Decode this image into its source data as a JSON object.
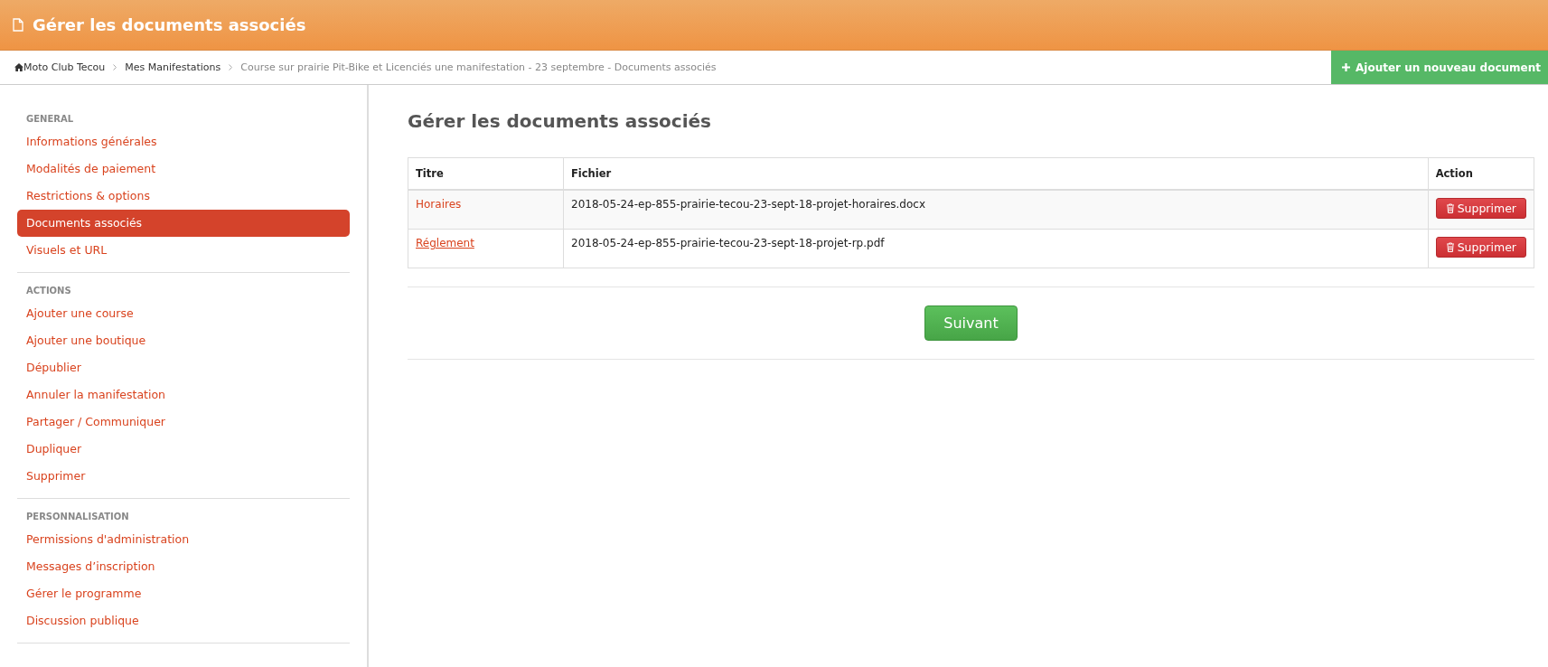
{
  "header": {
    "title": "Gérer les documents associés"
  },
  "breadcrumb": {
    "items": [
      {
        "label": "Moto Club Tecou",
        "kind": "home"
      },
      {
        "label": "Mes Manifestations",
        "kind": "link"
      },
      {
        "label": "Course sur prairie Pit-Bike et Licenciés une manifestation - 23 septembre - Documents associés",
        "kind": "current"
      }
    ],
    "action_button": "Ajouter un nouveau document"
  },
  "sidebar": {
    "sections": [
      {
        "heading": "GENERAL",
        "items": [
          {
            "label": "Informations générales",
            "selected": false
          },
          {
            "label": "Modalités de paiement",
            "selected": false
          },
          {
            "label": "Restrictions & options",
            "selected": false
          },
          {
            "label": "Documents associés",
            "selected": true
          },
          {
            "label": "Visuels et URL",
            "selected": false
          }
        ]
      },
      {
        "heading": "ACTIONS",
        "items": [
          {
            "label": "Ajouter une course",
            "selected": false
          },
          {
            "label": "Ajouter une boutique",
            "selected": false
          },
          {
            "label": "Dépublier",
            "selected": false
          },
          {
            "label": "Annuler la manifestation",
            "selected": false
          },
          {
            "label": "Partager / Communiquer",
            "selected": false
          },
          {
            "label": "Dupliquer",
            "selected": false
          },
          {
            "label": "Supprimer",
            "selected": false
          }
        ]
      },
      {
        "heading": "PERSONNALISATION",
        "items": [
          {
            "label": "Permissions d'administration",
            "selected": false
          },
          {
            "label": "Messages d’inscription",
            "selected": false
          },
          {
            "label": "Gérer le programme",
            "selected": false
          },
          {
            "label": "Discussion publique",
            "selected": false
          }
        ]
      }
    ]
  },
  "main": {
    "title": "Gérer les documents associés",
    "table": {
      "columns": [
        "Titre",
        "Fichier",
        "Action"
      ],
      "rows": [
        {
          "title": "Horaires",
          "file": "2018-05-24-ep-855-prairie-tecou-23-sept-18-projet-horaires.docx",
          "action": "Supprimer",
          "hovered": false
        },
        {
          "title": "Réglement",
          "file": "2018-05-24-ep-855-prairie-tecou-23-sept-18-projet-rp.pdf",
          "action": "Supprimer",
          "hovered": true
        }
      ]
    },
    "next_button": "Suivant"
  }
}
